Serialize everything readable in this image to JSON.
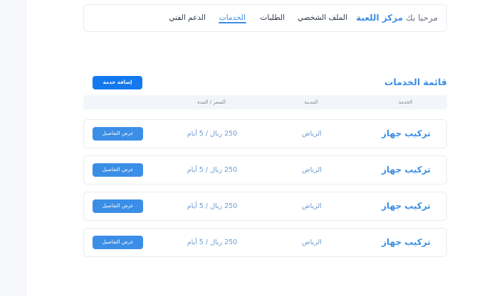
{
  "navbar": {
    "greeting_prefix": "مرحبا بك",
    "center_name": "مركز اللعبة",
    "links": [
      {
        "label": "الملف الشخصي"
      },
      {
        "label": "الطلبات"
      },
      {
        "label": "الخدمات",
        "active": true
      },
      {
        "label": "الدعم الفني"
      }
    ]
  },
  "services": {
    "title": "قائمة الخدمات",
    "add_label": "إضافة خدمة",
    "columns": {
      "service": "الخدمة",
      "city": "المدينة",
      "price": "السعر / المدة"
    },
    "rows": [
      {
        "service": "تركيب جهاز",
        "city": "الرياض",
        "price": "250 ريال / 5 أيام",
        "action": "عرض التفاصيل"
      },
      {
        "service": "تركيب جهاز",
        "city": "الرياض",
        "price": "250 ريال / 5 أيام",
        "action": "عرض التفاصيل"
      },
      {
        "service": "تركيب جهاز",
        "city": "الرياض",
        "price": "250 ريال / 5 أيام",
        "action": "عرض التفاصيل"
      },
      {
        "service": "تركيب جهاز",
        "city": "الرياض",
        "price": "250 ريال / 5 أيام",
        "action": "عرض التفاصيل"
      }
    ]
  },
  "colors": {
    "accent": "#3b8ee6",
    "button": "#1478ef"
  }
}
